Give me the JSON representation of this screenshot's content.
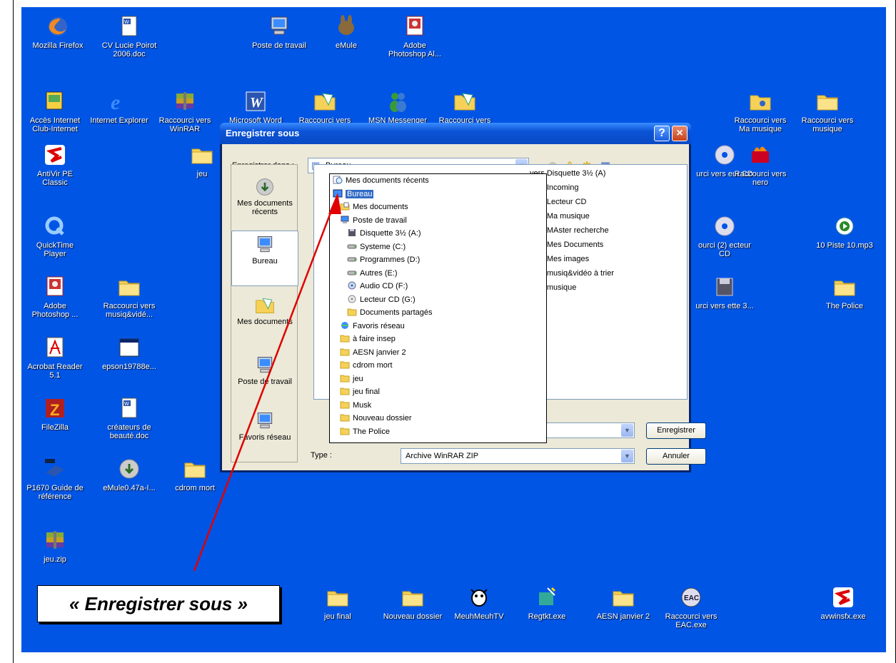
{
  "desktop": {
    "icons": [
      {
        "id": "firefox",
        "label": "Mozilla Firefox",
        "icon": "firefox-icon"
      },
      {
        "id": "cv",
        "label": "CV Lucie Poirot 2006.doc",
        "icon": "word-doc-icon"
      },
      {
        "id": "poste",
        "label": "Poste de travail",
        "icon": "computer-icon"
      },
      {
        "id": "emule",
        "label": "eMule",
        "icon": "emule-icon"
      },
      {
        "id": "photoshop1",
        "label": "Adobe Photoshop Al...",
        "icon": "photoshop-icon"
      },
      {
        "id": "acces",
        "label": "Accès Internet Club-Internet",
        "icon": "internet-club-icon"
      },
      {
        "id": "ie",
        "label": "Internet Explorer",
        "icon": "ie-icon"
      },
      {
        "id": "winrar",
        "label": "Raccourci vers WinRAR",
        "icon": "winrar-icon"
      },
      {
        "id": "word",
        "label": "Microsoft Word",
        "icon": "word-icon"
      },
      {
        "id": "racc1",
        "label": "Raccourci vers",
        "icon": "shortcut-folder-icon"
      },
      {
        "id": "msn",
        "label": "MSN Messenger",
        "icon": "msn-icon"
      },
      {
        "id": "racc2",
        "label": "Raccourci vers",
        "icon": "shortcut-folder-icon"
      },
      {
        "id": "mamusique",
        "label": "Raccourci vers Ma musique",
        "icon": "music-folder-icon"
      },
      {
        "id": "musique",
        "label": "Raccourci vers musique",
        "icon": "folder-icon"
      },
      {
        "id": "antivir",
        "label": "AntiVir PE Classic",
        "icon": "antivir-icon"
      },
      {
        "id": "jeu",
        "label": "jeu",
        "icon": "folder-icon"
      },
      {
        "id": "lecteurcd",
        "label": "urci vers eur CD",
        "icon": "cd-icon"
      },
      {
        "id": "nero",
        "label": "Raccourci vers nero",
        "icon": "nero-icon"
      },
      {
        "id": "quicktime",
        "label": "QuickTime Player",
        "icon": "quicktime-icon"
      },
      {
        "id": "lecteurcd2",
        "label": "ourci (2) ecteur CD",
        "icon": "cd-icon"
      },
      {
        "id": "piste",
        "label": "10 Piste 10.mp3",
        "icon": "mp3-icon"
      },
      {
        "id": "photoshop2",
        "label": "Adobe Photoshop ...",
        "icon": "photoshop-icon"
      },
      {
        "id": "musiqvideo",
        "label": "Raccourci vers musiq&vidé...",
        "icon": "folder-icon"
      },
      {
        "id": "disquette",
        "label": "urci vers ette 3...",
        "icon": "floppy-icon"
      },
      {
        "id": "police",
        "label": "The Police",
        "icon": "folder-icon"
      },
      {
        "id": "acrobat",
        "label": "Acrobat Reader 5.1",
        "icon": "acrobat-icon"
      },
      {
        "id": "epson",
        "label": "epson19788e...",
        "icon": "window-icon"
      },
      {
        "id": "filezilla",
        "label": "FileZilla",
        "icon": "filezilla-icon"
      },
      {
        "id": "createurs",
        "label": "créateurs de beauté.doc",
        "icon": "word-doc-icon"
      },
      {
        "id": "guide",
        "label": "P1670 Guide de référence",
        "icon": "epson-book-icon"
      },
      {
        "id": "emule047",
        "label": "eMule0.47a-I...",
        "icon": "installer-icon"
      },
      {
        "id": "cdrom",
        "label": "cdrom mort",
        "icon": "folder-icon"
      },
      {
        "id": "jeuzip",
        "label": "jeu.zip",
        "icon": "winrar-icon"
      },
      {
        "id": "musk",
        "label": "Musk",
        "icon": "folder-icon"
      },
      {
        "id": "afaire",
        "label": "à faire insep",
        "icon": "folder-icon"
      },
      {
        "id": "jeufinal",
        "label": "jeu final",
        "icon": "folder-icon"
      },
      {
        "id": "nouveau",
        "label": "Nouveau dossier",
        "icon": "folder-icon"
      },
      {
        "id": "meuh",
        "label": "MeuhMeuhTV",
        "icon": "cow-icon"
      },
      {
        "id": "regtkt",
        "label": "Regtkt.exe",
        "icon": "regtkt-icon"
      },
      {
        "id": "aesn",
        "label": "AESN janvier 2",
        "icon": "folder-icon"
      },
      {
        "id": "eac",
        "label": "Raccourci vers EAC.exe",
        "icon": "eac-icon"
      },
      {
        "id": "avwinsfx",
        "label": "avwinsfx.exe",
        "icon": "antivir-icon"
      }
    ]
  },
  "dialog": {
    "title": "Enregistrer sous",
    "help": "?",
    "close": "×",
    "save_in_label": "Enregistrer dans :",
    "save_in_value": "Bureau",
    "type_label": "Type :",
    "type_value": "Archive WinRAR ZIP",
    "save_button": "Enregistrer",
    "cancel_button": "Annuler",
    "places": [
      {
        "label": "Mes documents récents",
        "icon": "recent-docs-icon"
      },
      {
        "label": "Bureau",
        "icon": "desktop-icon"
      },
      {
        "label": "Mes documents",
        "icon": "my-documents-icon"
      },
      {
        "label": "Poste de travail",
        "icon": "computer-icon"
      },
      {
        "label": "Favoris réseau",
        "icon": "network-icon"
      }
    ],
    "files": [
      "vers Disquette 3½ (A)",
      "vers Incoming",
      "vers Lecteur CD",
      "vers Ma musique",
      "vers MAster recherche",
      "vers Mes Documents",
      "vers Mes images",
      "vers musiq&vidéo à trier",
      "vers musique"
    ],
    "dropdown": [
      {
        "label": "Mes documents récents",
        "icon": "recent-docs-icon",
        "level": 0
      },
      {
        "label": "Bureau",
        "icon": "desktop-icon",
        "level": 0,
        "selected": true
      },
      {
        "label": "Mes documents",
        "icon": "my-documents-icon",
        "level": 1
      },
      {
        "label": "Poste de travail",
        "icon": "computer-icon",
        "level": 1
      },
      {
        "label": "Disquette 3½ (A:)",
        "icon": "floppy-icon",
        "level": 2
      },
      {
        "label": "Systeme (C:)",
        "icon": "drive-icon",
        "level": 2
      },
      {
        "label": "Programmes (D:)",
        "icon": "drive-icon",
        "level": 2
      },
      {
        "label": "Autres (E:)",
        "icon": "drive-icon",
        "level": 2
      },
      {
        "label": "Audio CD (F:)",
        "icon": "audio-cd-icon",
        "level": 2
      },
      {
        "label": "Lecteur CD (G:)",
        "icon": "cd-drive-icon",
        "level": 2
      },
      {
        "label": "Documents partagés",
        "icon": "folder-icon",
        "level": 2
      },
      {
        "label": "Favoris réseau",
        "icon": "network-icon",
        "level": 1
      },
      {
        "label": "à faire insep",
        "icon": "folder-icon",
        "level": 1
      },
      {
        "label": "AESN janvier 2",
        "icon": "folder-icon",
        "level": 1
      },
      {
        "label": "cdrom mort",
        "icon": "folder-icon",
        "level": 1
      },
      {
        "label": "jeu",
        "icon": "folder-icon",
        "level": 1
      },
      {
        "label": "jeu final",
        "icon": "folder-icon",
        "level": 1
      },
      {
        "label": "Musk",
        "icon": "folder-icon",
        "level": 1
      },
      {
        "label": "Nouveau dossier",
        "icon": "folder-icon",
        "level": 1
      },
      {
        "label": "The Police",
        "icon": "folder-icon",
        "level": 1
      }
    ]
  },
  "callout": {
    "text": "« Enregistrer sous »"
  },
  "colors": {
    "desktop": "#0055e5",
    "selection": "#316ac5",
    "arrow": "#e00000"
  }
}
